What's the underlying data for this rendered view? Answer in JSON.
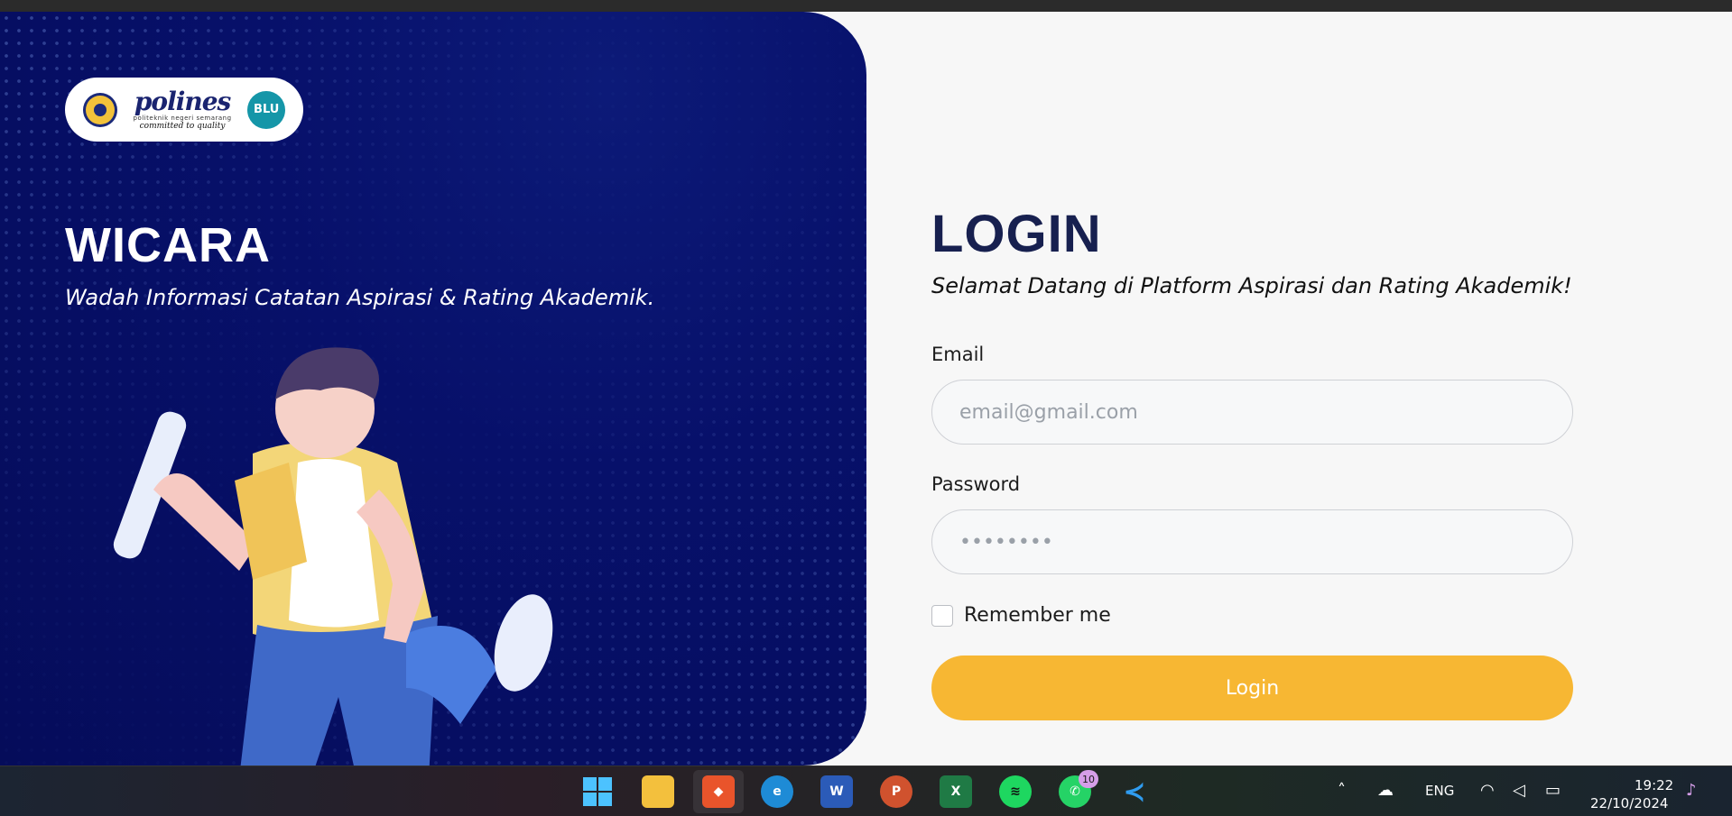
{
  "brand": {
    "logo_word": "polines",
    "logo_sub": "politeknik negeri semarang",
    "logo_tag": "committed to quality",
    "badge": "BLU"
  },
  "hero": {
    "title": "WICARA",
    "subtitle": "Wadah Informasi Catatan Aspirasi & Rating Akademik."
  },
  "login": {
    "title": "LOGIN",
    "subtitle": "Selamat Datang di Platform Aspirasi dan Rating Akademik!",
    "email_label": "Email",
    "email_placeholder": "email@gmail.com",
    "password_label": "Password",
    "password_placeholder": "••••••••",
    "remember_label": "Remember me",
    "button_label": "Login"
  },
  "taskbar": {
    "whatsapp_badge": "10",
    "language": "ENG",
    "time": "19:22",
    "date": "22/10/2024"
  },
  "colors": {
    "hero_bg": "#07106a",
    "login_title": "#17204f",
    "button": "#f7b733"
  }
}
